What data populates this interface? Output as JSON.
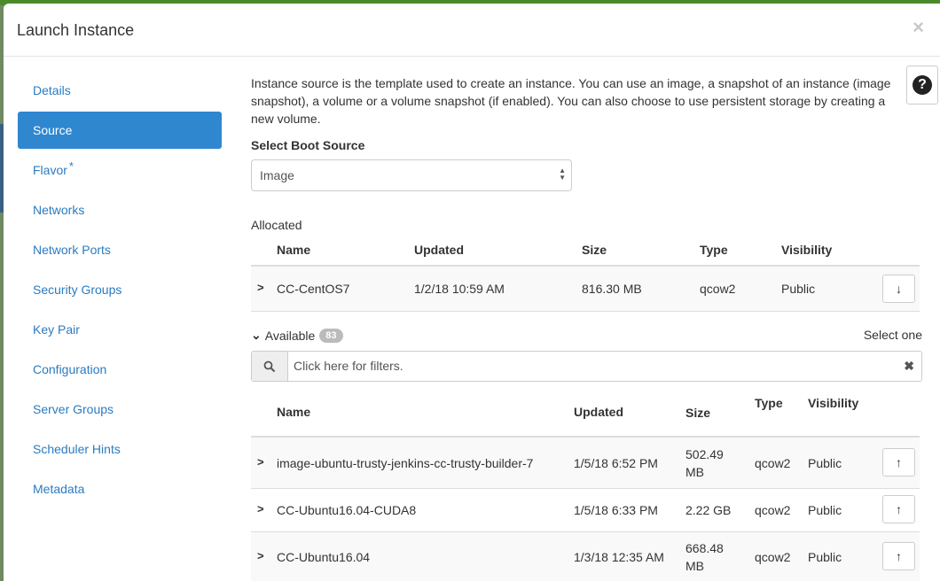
{
  "modal": {
    "title": "Launch Instance",
    "close_label": "×"
  },
  "sidebar": {
    "items": [
      {
        "label": "Details"
      },
      {
        "label": "Source"
      },
      {
        "label": "Flavor",
        "required_marker": "*"
      },
      {
        "label": "Networks"
      },
      {
        "label": "Network Ports"
      },
      {
        "label": "Security Groups"
      },
      {
        "label": "Key Pair"
      },
      {
        "label": "Configuration"
      },
      {
        "label": "Server Groups"
      },
      {
        "label": "Scheduler Hints"
      },
      {
        "label": "Metadata"
      }
    ],
    "active_index": 1
  },
  "help": {
    "icon": "question-circle-icon",
    "label": "?"
  },
  "source": {
    "intro": "Instance source is the template used to create an instance. You can use an image, a snapshot of an instance (image snapshot), a volume or a volume snapshot (if enabled). You can also choose to use persistent storage by creating a new volume.",
    "boot_source_label": "Select Boot Source",
    "boot_source_value": "Image"
  },
  "allocated": {
    "label": "Allocated",
    "headers": {
      "name": "Name",
      "updated": "Updated",
      "size": "Size",
      "type": "Type",
      "visibility": "Visibility"
    },
    "rows": [
      {
        "name": "CC-CentOS7",
        "updated": "1/2/18 10:59 AM",
        "size": "816.30 MB",
        "type": "qcow2",
        "visibility": "Public",
        "action_icon": "arrow-down-icon"
      }
    ]
  },
  "available": {
    "label": "Available",
    "count": "83",
    "select_hint": "Select one",
    "filter_placeholder": "Click here for filters.",
    "headers": {
      "name": "Name",
      "updated": "Updated",
      "size": "Size",
      "type": "Type",
      "visibility": "Visibility"
    },
    "rows": [
      {
        "name": "image-ubuntu-trusty-jenkins-cc-trusty-builder-7",
        "updated": "1/5/18 6:52 PM",
        "size_line1": "502.49",
        "size_line2": "MB",
        "type": "qcow2",
        "visibility": "Public",
        "action_icon": "arrow-up-icon"
      },
      {
        "name": "CC-Ubuntu16.04-CUDA8",
        "updated": "1/5/18 6:33 PM",
        "size_line1": "2.22 GB",
        "size_line2": "",
        "type": "qcow2",
        "visibility": "Public",
        "action_icon": "arrow-up-icon"
      },
      {
        "name": "CC-Ubuntu16.04",
        "updated": "1/3/18 12:35 AM",
        "size_line1": "668.48",
        "size_line2": "MB",
        "type": "qcow2",
        "visibility": "Public",
        "action_icon": "arrow-up-icon"
      }
    ]
  },
  "colors": {
    "accent": "#2f87d0",
    "link": "#2a7bc0"
  }
}
